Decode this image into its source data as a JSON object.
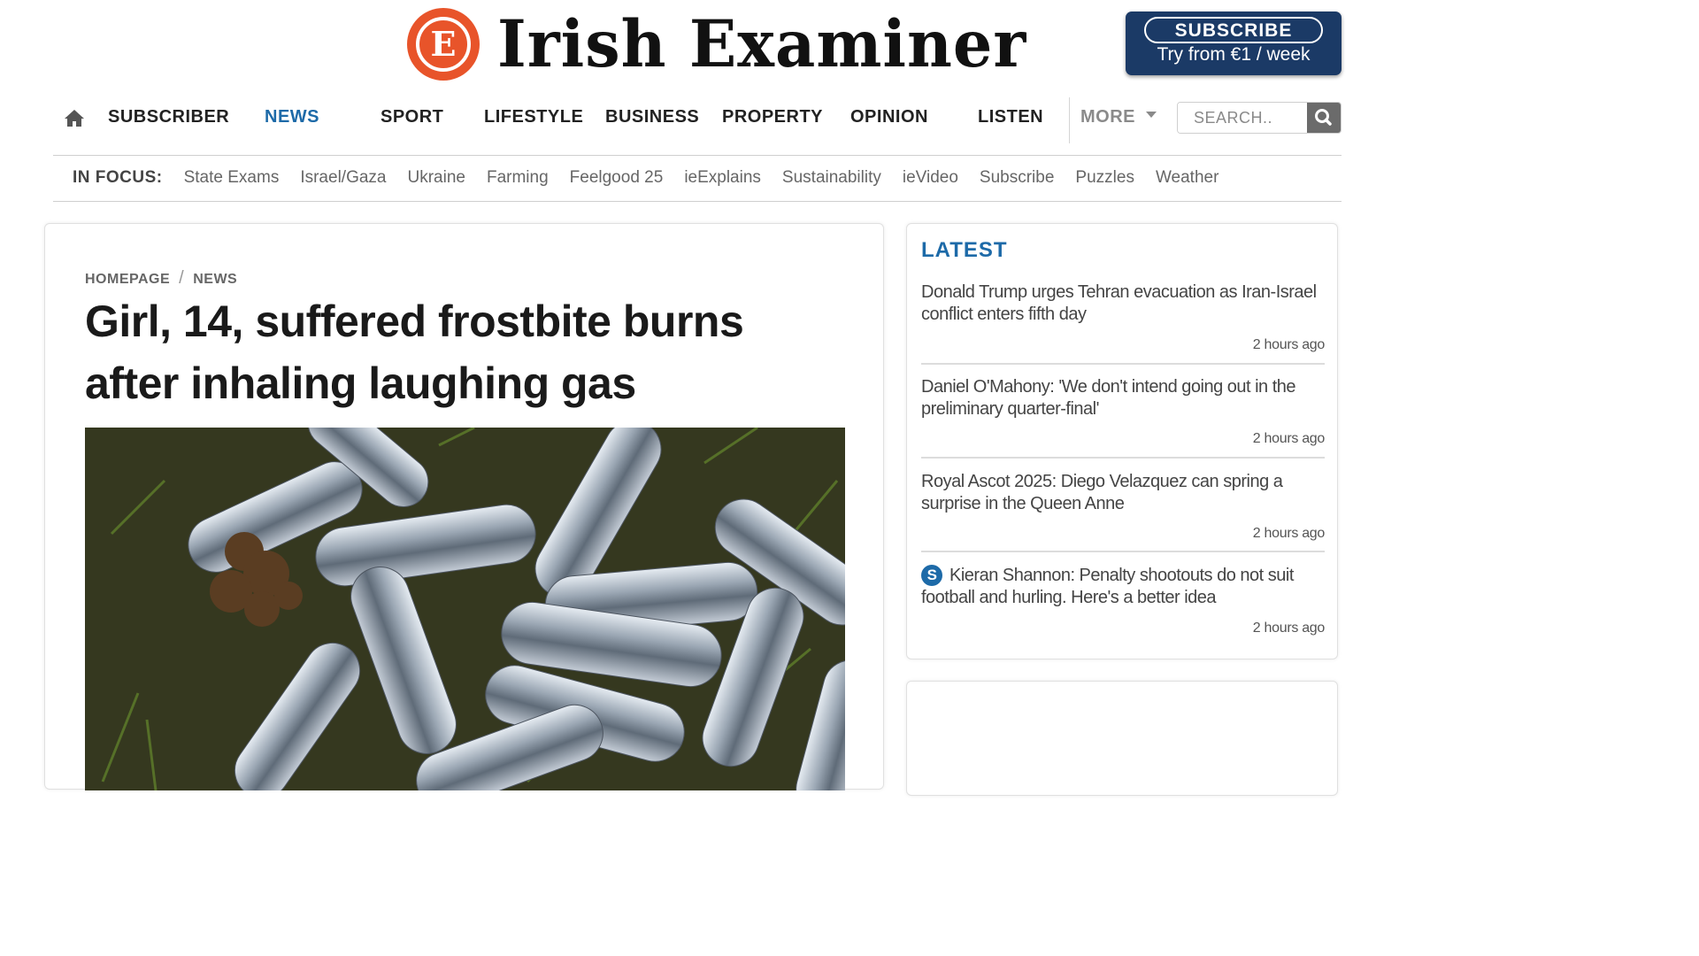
{
  "brand": {
    "logo_letter": "E",
    "name": "Irish Examiner",
    "accent": "#e8542a",
    "navy": "#1b3a66",
    "link_blue": "#1d6aa8"
  },
  "subscribe": {
    "label": "SUBSCRIBE",
    "sub": "Try from €1 / week"
  },
  "nav": {
    "home_icon": "home-icon",
    "items": [
      "SUBSCRIBER",
      "NEWS",
      "SPORT",
      "LIFESTYLE",
      "BUSINESS",
      "PROPERTY",
      "OPINION",
      "LISTEN"
    ],
    "active": "NEWS",
    "more_label": "MORE",
    "search_placeholder": "SEARCH..",
    "search_icon": "search-icon"
  },
  "in_focus": {
    "label": "IN FOCUS:",
    "links": [
      "State Exams",
      "Israel/Gaza",
      "Ukraine",
      "Farming",
      "Feelgood 25",
      "ieExplains",
      "Sustainability",
      "ieVideo",
      "Subscribe",
      "Puzzles",
      "Weather"
    ]
  },
  "article": {
    "breadcrumb": [
      "HOMEPAGE",
      "NEWS"
    ],
    "breadcrumb_sep": "/",
    "headline": "Girl, 14, suffered frostbite burns after inhaling laughing gas",
    "image_subject": "nitrous oxide canisters on grass"
  },
  "latest": {
    "title": "LATEST",
    "items": [
      {
        "headline": "Donald Trump urges Tehran evacuation as Iran-Israel conflict enters fifth day",
        "time": "2 hours ago",
        "subscriber": false
      },
      {
        "headline": "Daniel O'Mahony: 'We don't intend going out in the preliminary quarter-final'",
        "time": "2 hours ago",
        "subscriber": false
      },
      {
        "headline": "Royal Ascot 2025: Diego Velazquez can spring a surprise in the Queen Anne",
        "time": "2 hours ago",
        "subscriber": false
      },
      {
        "headline": "Kieran Shannon: Penalty shootouts do not suit football and hurling. Here's a better idea",
        "time": "2 hours ago",
        "subscriber": true
      }
    ],
    "subscriber_badge": "S"
  }
}
